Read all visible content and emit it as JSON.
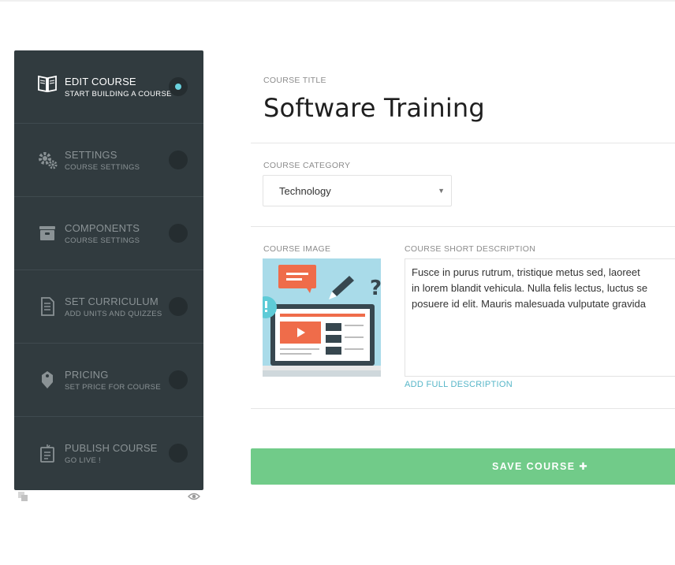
{
  "sidebar": {
    "steps": [
      {
        "title": "EDIT COURSE",
        "subtitle": "START BUILDING A COURSE",
        "icon": "open-book-icon",
        "active": true
      },
      {
        "title": "SETTINGS",
        "subtitle": "COURSE SETTINGS",
        "icon": "gears-icon",
        "active": false
      },
      {
        "title": "COMPONENTS",
        "subtitle": "COURSE SETTINGS",
        "icon": "archive-box-icon",
        "active": false
      },
      {
        "title": "SET CURRICULUM",
        "subtitle": "ADD UNITS AND QUIZZES",
        "icon": "document-icon",
        "active": false
      },
      {
        "title": "PRICING",
        "subtitle": "SET PRICE FOR COURSE",
        "icon": "price-tag-icon",
        "active": false
      },
      {
        "title": "PUBLISH COURSE",
        "subtitle": "GO LIVE !",
        "icon": "publish-screen-icon",
        "active": false
      }
    ],
    "footer_icons": [
      "copy-icon",
      "eye-icon"
    ]
  },
  "form": {
    "course_title_label": "COURSE TITLE",
    "course_title": "Software Training",
    "category_label": "COURSE CATEGORY",
    "category_value": "Technology",
    "image_label": "COURSE IMAGE",
    "short_desc_label": "COURSE SHORT DESCRIPTION",
    "short_desc": "Fusce in purus rutrum, tristique metus sed, laoreet\nin lorem blandit vehicula. Nulla felis lectus, luctus se\nposuere id elit. Mauris malesuada vulputate gravida",
    "add_full_description": "ADD FULL DESCRIPTION",
    "save_label": "SAVE COURSE ✚"
  },
  "colors": {
    "sidebar_bg": "#313b3f",
    "active_dot": "#6ad1dd",
    "save_button": "#71cb89",
    "link": "#57b6c8"
  }
}
